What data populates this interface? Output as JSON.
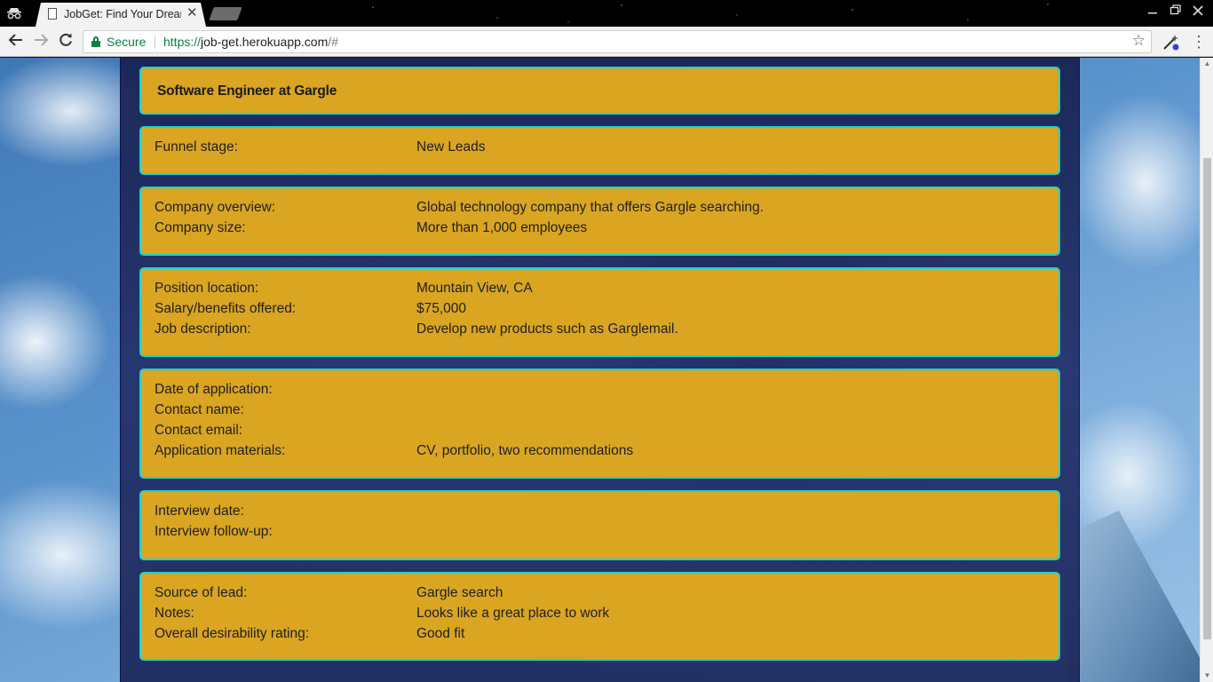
{
  "browser": {
    "tab_title": "JobGet: Find Your Dream",
    "tab_close": "✕",
    "secure_label": "Secure",
    "url_protocol": "https://",
    "url_host": "job-get.herokuapp.com",
    "url_path": "/#",
    "icons": [
      "incognito-icon",
      "page-icon",
      "back-icon",
      "forward-icon",
      "reload-icon",
      "lock-icon",
      "bookmark-star-icon",
      "extension-icon",
      "menu-icon"
    ]
  },
  "job": {
    "title": "Software Engineer at Gargle",
    "funnel": {
      "label": "Funnel stage:",
      "value": "New Leads"
    },
    "company": [
      {
        "label": "Company overview:",
        "value": "Global technology company that offers Gargle searching."
      },
      {
        "label": "Company size:",
        "value": "More than 1,000 employees"
      }
    ],
    "position": [
      {
        "label": "Position location:",
        "value": "Mountain View, CA"
      },
      {
        "label": "Salary/benefits offered:",
        "value": "$75,000"
      },
      {
        "label": "Job description:",
        "value": "Develop new products such as Garglemail."
      }
    ],
    "application": [
      {
        "label": "Date of application:",
        "value": ""
      },
      {
        "label": "Contact name:",
        "value": ""
      },
      {
        "label": "Contact email:",
        "value": ""
      },
      {
        "label": "Application materials:",
        "value": "CV, portfolio, two recommendations"
      }
    ],
    "interview": [
      {
        "label": "Interview date:",
        "value": ""
      },
      {
        "label": "Interview follow-up:",
        "value": ""
      }
    ],
    "source": [
      {
        "label": "Source of lead:",
        "value": "Gargle search"
      },
      {
        "label": "Notes:",
        "value": "Looks like a great place to work"
      },
      {
        "label": "Overall desirability rating:",
        "value": "Good fit"
      }
    ]
  },
  "colors": {
    "card_bg": "#daa520",
    "card_border": "#19d3d3",
    "panel_bg": "#1c2a66",
    "secure_green": "#0b8043"
  }
}
